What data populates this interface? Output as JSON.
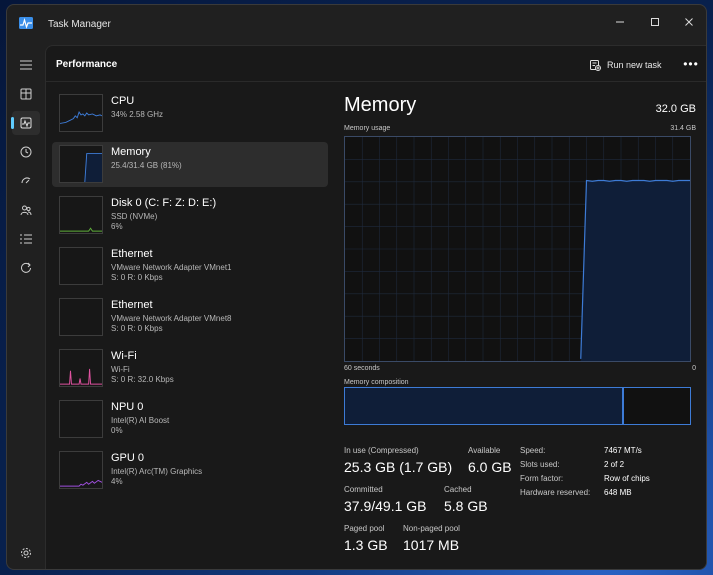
{
  "window": {
    "title": "Task Manager"
  },
  "colors": {
    "accent": "#60cdff",
    "memory_line": "#3d7bd6",
    "memory_fill": "#0f1e38",
    "network_line": "#e052a0"
  },
  "nav": {
    "items": [
      {
        "id": "menu",
        "icon": "hamburger-icon"
      },
      {
        "id": "processes",
        "icon": "processes-icon"
      },
      {
        "id": "performance",
        "icon": "performance-icon",
        "active": true
      },
      {
        "id": "app-history",
        "icon": "history-icon"
      },
      {
        "id": "startup",
        "icon": "startup-icon"
      },
      {
        "id": "users",
        "icon": "users-icon"
      },
      {
        "id": "details",
        "icon": "details-icon"
      },
      {
        "id": "services",
        "icon": "services-icon"
      },
      {
        "id": "settings",
        "icon": "settings-icon"
      }
    ]
  },
  "header": {
    "page_title": "Performance",
    "run_new_task": "Run new task",
    "more": "•••"
  },
  "devices": [
    {
      "name": "CPU",
      "line2": "34%  2.58 GHz",
      "line3": "",
      "graph": "cpu",
      "selected": false
    },
    {
      "name": "Memory",
      "line2": "25.4/31.4 GB (81%)",
      "line3": "",
      "graph": "memory",
      "selected": true
    },
    {
      "name": "Disk 0 (C: F: Z: D: E:)",
      "line2": "SSD (NVMe)",
      "line3": "6%",
      "graph": "disk",
      "selected": false
    },
    {
      "name": "Ethernet",
      "line2": "VMware Network Adapter VMnet1",
      "line3": "S: 0  R: 0 Kbps",
      "graph": "none",
      "selected": false
    },
    {
      "name": "Ethernet",
      "line2": "VMware Network Adapter VMnet8",
      "line3": "S: 0  R: 0 Kbps",
      "graph": "none",
      "selected": false
    },
    {
      "name": "Wi-Fi",
      "line2": "Wi-Fi",
      "line3": "S: 0  R: 32.0 Kbps",
      "graph": "wifi",
      "selected": false
    },
    {
      "name": "NPU 0",
      "line2": "Intel(R) AI Boost",
      "line3": "0%",
      "graph": "none",
      "selected": false
    },
    {
      "name": "GPU 0",
      "line2": "Intel(R) Arc(TM) Graphics",
      "line3": "4%",
      "graph": "gpu",
      "selected": false
    }
  ],
  "detail": {
    "title": "Memory",
    "total": "32.0 GB",
    "usage_label": "Memory usage",
    "usage_max": "31.4 GB",
    "axis_left": "60 seconds",
    "axis_right": "0",
    "composition_label": "Memory composition",
    "composition_in_use_fraction": 0.81,
    "stats": {
      "in_use_label": "In use (Compressed)",
      "in_use_value": "25.3 GB (1.7 GB)",
      "available_label": "Available",
      "available_value": "6.0 GB",
      "committed_label": "Committed",
      "committed_value": "37.9/49.1 GB",
      "cached_label": "Cached",
      "cached_value": "5.8 GB",
      "paged_label": "Paged pool",
      "paged_value": "1.3 GB",
      "nonpaged_label": "Non-paged pool",
      "nonpaged_value": "1017 MB"
    },
    "specs": [
      {
        "label": "Speed:",
        "value": "7467 MT/s"
      },
      {
        "label": "Slots used:",
        "value": "2 of 2"
      },
      {
        "label": "Form factor:",
        "value": "Row of chips"
      },
      {
        "label": "Hardware reserved:",
        "value": "648 MB"
      }
    ]
  },
  "chart_data": {
    "type": "area",
    "title": "Memory usage",
    "xlabel": "60 seconds",
    "x": [
      60,
      59,
      58,
      57,
      56,
      55,
      54,
      53,
      52,
      51,
      50,
      49,
      48,
      47,
      46,
      45,
      44,
      43,
      42,
      41,
      40,
      39,
      38,
      37,
      36,
      35,
      34,
      33,
      32,
      31,
      30,
      29,
      28,
      27,
      26,
      25,
      24,
      23,
      22,
      21,
      20,
      19,
      18,
      17,
      16,
      15,
      14,
      13,
      12,
      11,
      10,
      9,
      8,
      7,
      6,
      5,
      4,
      3,
      2,
      1,
      0
    ],
    "series": [
      {
        "values": [
          null,
          null,
          null,
          null,
          null,
          null,
          null,
          null,
          null,
          null,
          null,
          null,
          null,
          null,
          null,
          null,
          null,
          null,
          null,
          null,
          null,
          null,
          null,
          null,
          null,
          null,
          null,
          null,
          null,
          null,
          null,
          null,
          null,
          null,
          null,
          null,
          null,
          null,
          null,
          null,
          null,
          0.3,
          25.3,
          25.2,
          25.3,
          25.3,
          25.2,
          25.3,
          25.3,
          25.2,
          25.3,
          25.3,
          25.3,
          25.2,
          25.3,
          25.3,
          25.3,
          25.2,
          25.3,
          25.3,
          25.3
        ]
      }
    ],
    "ylim": [
      0,
      31.4
    ],
    "grid": true
  }
}
